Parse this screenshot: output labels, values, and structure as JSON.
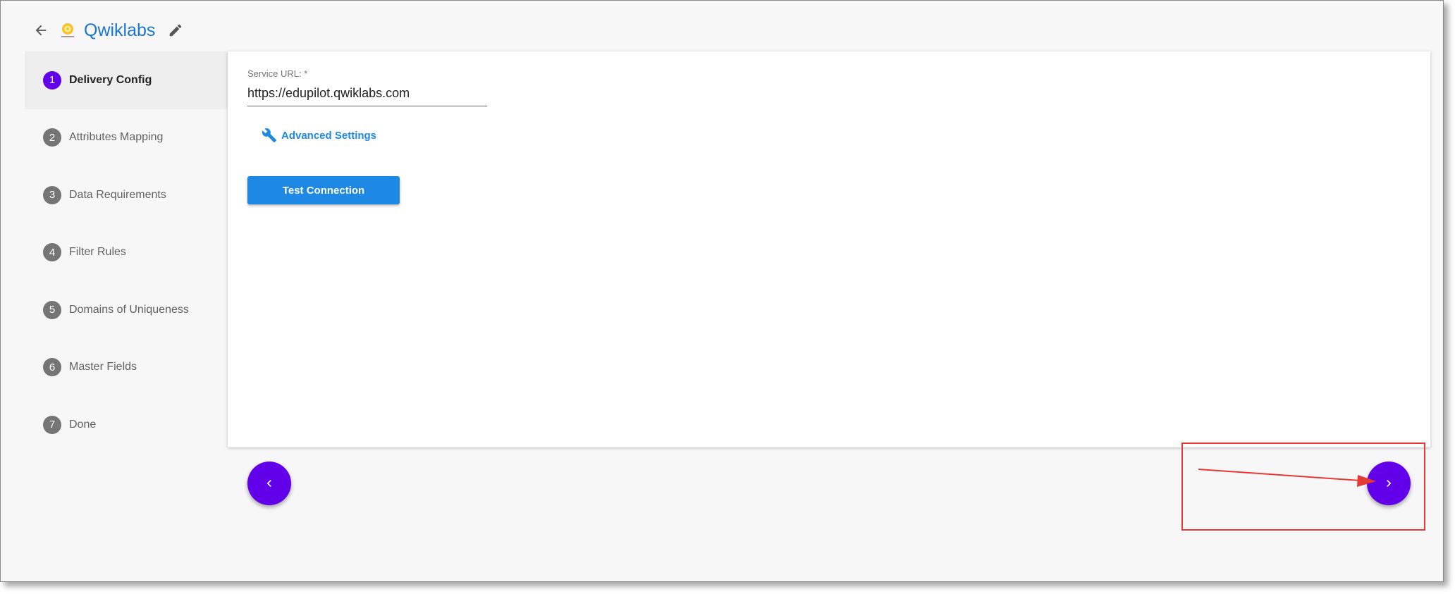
{
  "header": {
    "title": "Qwiklabs",
    "back_icon": "arrow-left-icon",
    "edit_icon": "pencil-icon"
  },
  "stepper": {
    "steps": [
      {
        "num": "1",
        "label": "Delivery Config",
        "active": true
      },
      {
        "num": "2",
        "label": "Attributes Mapping"
      },
      {
        "num": "3",
        "label": "Data Requirements"
      },
      {
        "num": "4",
        "label": "Filter Rules"
      },
      {
        "num": "5",
        "label": "Domains of Uniqueness"
      },
      {
        "num": "6",
        "label": "Master Fields"
      },
      {
        "num": "7",
        "label": "Done"
      }
    ]
  },
  "form": {
    "service_url_label": "Service URL: *",
    "service_url_value": "https://edupilot.qwiklabs.com",
    "advanced_settings_label": "Advanced Settings",
    "test_connection_label": "Test Connection"
  },
  "nav": {
    "prev_icon": "chevron-left-icon",
    "next_icon": "chevron-right-icon"
  },
  "colors": {
    "accent": "#6200ea",
    "link": "#1e88e5",
    "title": "#1976d2",
    "annotation": "#e53935"
  }
}
